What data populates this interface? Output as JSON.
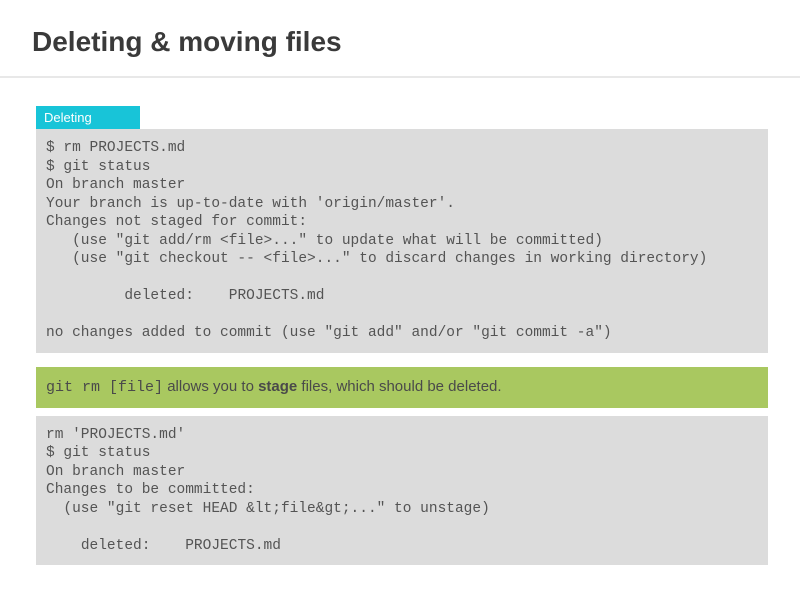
{
  "title": "Deleting & moving files",
  "sections": {
    "deleting": {
      "label": "Deleting",
      "code1": "$ rm PROJECTS.md\n$ git status\nOn branch master\nYour branch is up-to-date with 'origin/master'.\nChanges not staged for commit:\n   (use \"git add/rm <file>...\" to update what will be committed)\n   (use \"git checkout -- <file>...\" to discard changes in working directory)\n\n         deleted:    PROJECTS.md\n\nno changes added to commit (use \"git add\" and/or \"git commit -a\")",
      "hint": {
        "cmd": "git rm [file]",
        "before": " allows you to ",
        "stage": "stage",
        "after": " files, which should be deleted."
      },
      "code2": "rm 'PROJECTS.md'\n$ git status\nOn branch master\nChanges to be committed:\n  (use \"git reset HEAD &lt;file&gt;...\" to unstage)\n\n    deleted:    PROJECTS.md"
    }
  }
}
